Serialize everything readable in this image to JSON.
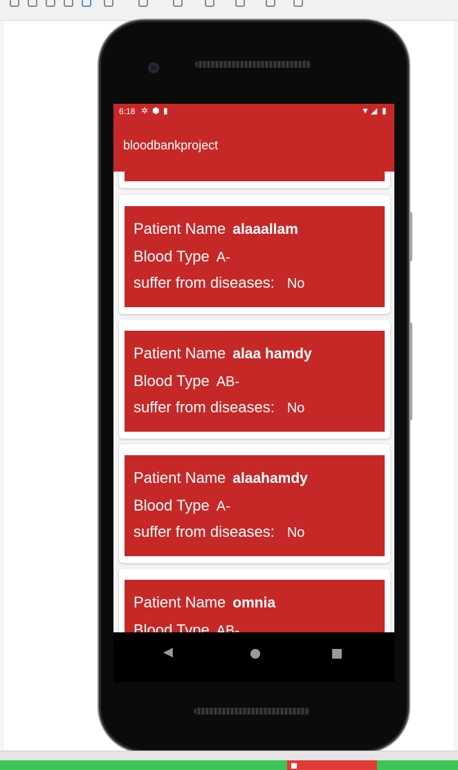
{
  "status_bar": {
    "time": "6:18",
    "left_icons": [
      "gear-icon",
      "shield-icon",
      "sd-card-icon"
    ],
    "right_icons": [
      "wifi-icon",
      "signal-icon",
      "battery-icon"
    ]
  },
  "app_bar": {
    "title": "bloodbankproject"
  },
  "labels": {
    "patient_name": "Patient Name",
    "blood_type": "Blood Type",
    "suffer_from": "suffer from",
    "diseases": "diseases:"
  },
  "patients": [
    {
      "name": "alaaallam",
      "blood_type": "A-",
      "diseases": "No"
    },
    {
      "name": "alaa hamdy",
      "blood_type": "AB-",
      "diseases": "No"
    },
    {
      "name": "alaahamdy",
      "blood_type": "A-",
      "diseases": "No"
    },
    {
      "name": "omnia",
      "blood_type": "AB-",
      "diseases": ""
    }
  ],
  "nav_bar": {
    "icons": [
      "back-icon",
      "home-icon",
      "recents-icon"
    ]
  },
  "colors": {
    "primary": "#c62828",
    "phone_body": "#0b0b0b",
    "nav_bar": "#000000"
  }
}
